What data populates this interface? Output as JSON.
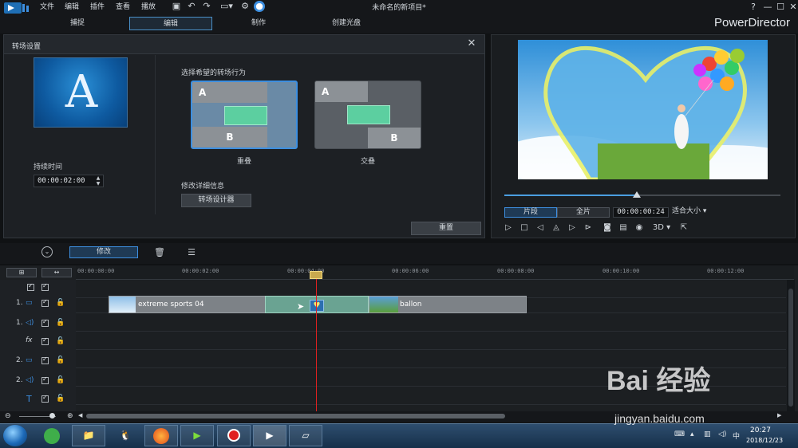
{
  "app": {
    "title": "未命名的新项目*",
    "brand": "PowerDirector",
    "menu": [
      "文件",
      "编辑",
      "插件",
      "查看",
      "播放"
    ],
    "modes": [
      "捕捉",
      "编辑",
      "制作",
      "创建光盘"
    ],
    "active_mode": "编辑",
    "help": "?"
  },
  "dialog": {
    "title": "转场设置",
    "duration_label": "持续时间",
    "duration_value": "00:00:02:00",
    "choose_label": "选择希望的转场行为",
    "behaviors": [
      {
        "label": "重叠",
        "a": "A",
        "b": "B",
        "selected": true
      },
      {
        "label": "交叠",
        "a": "A",
        "b": "B",
        "selected": false
      }
    ],
    "modify_label": "修改详细信息",
    "designer_button": "转场设计器",
    "reset_button": "重置"
  },
  "preview": {
    "clip_button": "片段",
    "movie_button": "全片",
    "timecode": "00:00:00:24",
    "fit": "适合大小",
    "mode_3d": "3D",
    "progress": 0.48
  },
  "toolbar": {
    "modify_tab": "修改"
  },
  "timeline": {
    "ticks": [
      "00:00:00:00",
      "00:00:02:00",
      "00:00:04:00",
      "00:00:06:00",
      "00:00:08:00",
      "00:00:10:00",
      "00:00:12:00"
    ],
    "tracks": [
      {
        "num": "1.",
        "type": "video"
      },
      {
        "num": "1.",
        "type": "audio"
      },
      {
        "num": "",
        "type": "fx"
      },
      {
        "num": "2.",
        "type": "video"
      },
      {
        "num": "2.",
        "type": "audio"
      },
      {
        "num": "",
        "type": "title"
      }
    ],
    "clips": [
      "extreme sports 04",
      "ballon"
    ]
  },
  "taskbar": {
    "time": "20:27",
    "date": "2018/12/23"
  },
  "watermark": {
    "brand": "Bai 经验",
    "url": "jingyan.baidu.com"
  }
}
